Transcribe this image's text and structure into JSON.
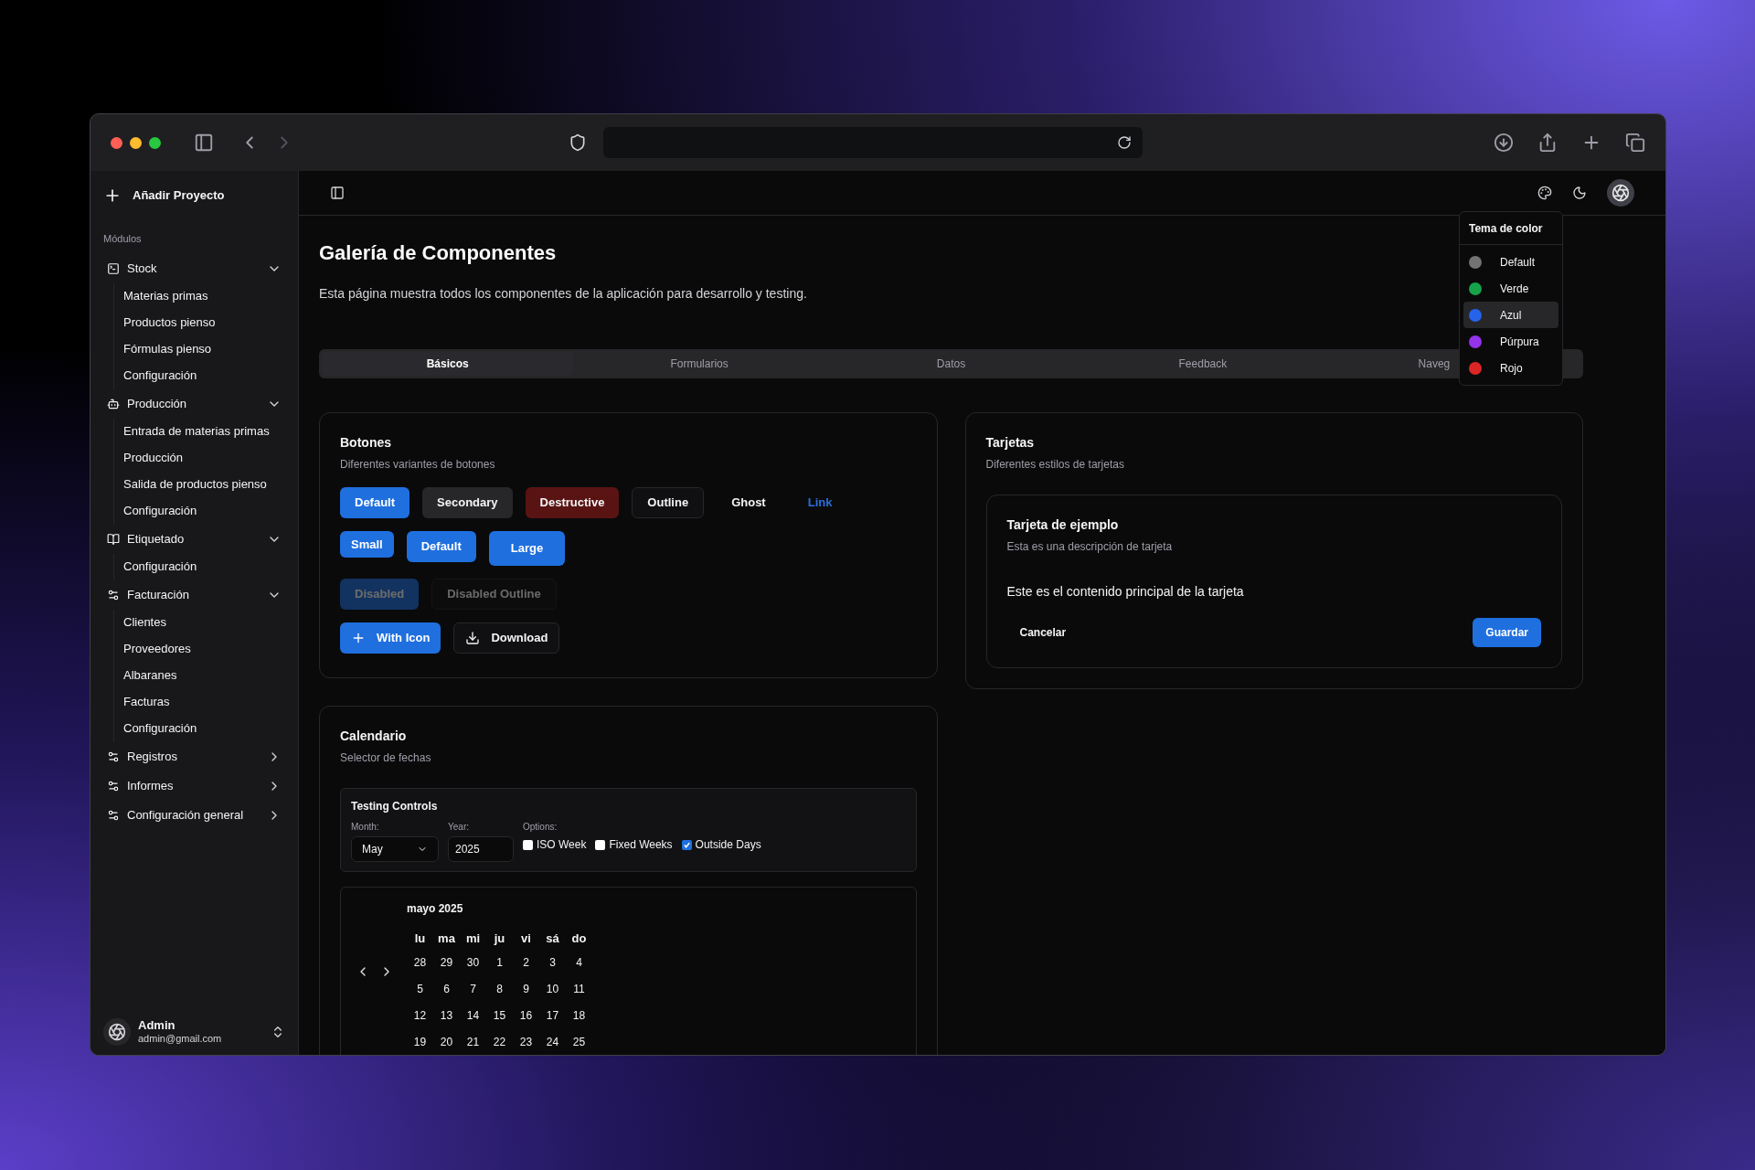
{
  "sidebar": {
    "add_project": "Añadir Proyecto",
    "section_label": "Módulos",
    "items": [
      {
        "label": "Stock",
        "kind": "terminal",
        "expanded": true,
        "children": [
          {
            "label": "Materias primas"
          },
          {
            "label": "Productos pienso"
          },
          {
            "label": "Fórmulas pienso"
          },
          {
            "label": "Configuración"
          }
        ]
      },
      {
        "label": "Producción",
        "kind": "bot",
        "expanded": true,
        "children": [
          {
            "label": "Entrada de materias primas"
          },
          {
            "label": "Producción"
          },
          {
            "label": "Salida de productos pienso"
          },
          {
            "label": "Configuración"
          }
        ]
      },
      {
        "label": "Etiquetado",
        "kind": "book",
        "expanded": true,
        "children": [
          {
            "label": "Configuración"
          }
        ]
      },
      {
        "label": "Facturación",
        "kind": "sliders",
        "expanded": true,
        "children": [
          {
            "label": "Clientes"
          },
          {
            "label": "Proveedores"
          },
          {
            "label": "Albaranes"
          },
          {
            "label": "Facturas"
          },
          {
            "label": "Configuración"
          }
        ]
      },
      {
        "label": "Registros",
        "kind": "sliders",
        "expanded": false
      },
      {
        "label": "Informes",
        "kind": "sliders",
        "expanded": false
      },
      {
        "label": "Configuración general",
        "kind": "sliders",
        "expanded": false
      }
    ],
    "user": {
      "name": "Admin",
      "email": "admin@gmail.com"
    }
  },
  "page": {
    "title": "Galería de Componentes",
    "description": "Esta página muestra todos los componentes de la aplicación para desarrollo y testing."
  },
  "tabs": [
    {
      "label": "Básicos",
      "selected": true
    },
    {
      "label": "Formularios",
      "selected": false
    },
    {
      "label": "Datos",
      "selected": false
    },
    {
      "label": "Feedback",
      "selected": false
    },
    {
      "label": "Naveg",
      "selected": false
    }
  ],
  "color_theme_menu": {
    "title": "Tema de color",
    "options": [
      {
        "label": "Default",
        "color": "#737373",
        "selected": false
      },
      {
        "label": "Verde",
        "color": "#16a34a",
        "selected": false
      },
      {
        "label": "Azul",
        "color": "#2563eb",
        "selected": true
      },
      {
        "label": "Púrpura",
        "color": "#9333ea",
        "selected": false
      },
      {
        "label": "Rojo",
        "color": "#dc2626",
        "selected": false
      }
    ]
  },
  "buttons_card": {
    "title": "Botones",
    "description": "Diferentes variantes de botones",
    "button_rows": [
      {
        "buttons": [
          {
            "label": "Default",
            "kind": "default",
            "disabled": false
          },
          {
            "label": "Secondary",
            "kind": "secondary",
            "disabled": false
          },
          {
            "label": "Destructive",
            "kind": "destructive",
            "disabled": false
          },
          {
            "label": "Outline",
            "kind": "outline",
            "disabled": false
          },
          {
            "label": "Ghost",
            "kind": "ghost",
            "disabled": false
          },
          {
            "label": "Link",
            "kind": "link",
            "disabled": false
          }
        ]
      },
      {
        "buttons": [
          {
            "label": "Small",
            "kind": "small",
            "disabled": false
          },
          {
            "label": "Default",
            "kind": "default",
            "disabled": false
          },
          {
            "label": "Large",
            "kind": "large",
            "disabled": false
          }
        ]
      },
      {
        "buttons": [
          {
            "label": "Disabled",
            "kind": "default",
            "disabled": true
          },
          {
            "label": "Disabled Outline",
            "kind": "outline",
            "disabled": true
          }
        ]
      },
      {
        "buttons": [
          {
            "label": "With Icon",
            "kind": "plus",
            "disabled": false
          },
          {
            "label": "Download",
            "kind": "download",
            "disabled": false
          }
        ]
      }
    ]
  },
  "cards_card": {
    "title": "Tarjetas",
    "description": "Diferentes estilos de tarjetas",
    "example": {
      "title": "Tarjeta de ejemplo",
      "description": "Esta es una descripción de tarjeta",
      "content": "Este es el contenido principal de la tarjeta",
      "cancel": "Cancelar",
      "save": "Guardar"
    }
  },
  "calendar_card": {
    "title": "Calendario",
    "description": "Selector de fechas",
    "controls": {
      "title": "Testing Controls",
      "month_label": "Month:",
      "month_value": "May",
      "year_label": "Year:",
      "year_value": "2025",
      "options_label": "Options:",
      "options": [
        {
          "label": "ISO Week",
          "checked": false
        },
        {
          "label": "Fixed Weeks",
          "checked": false
        },
        {
          "label": "Outside Days",
          "checked": true
        }
      ]
    },
    "calendar": {
      "caption": "mayo 2025",
      "weekdays": [
        "lu",
        "ma",
        "mi",
        "ju",
        "vi",
        "sá",
        "do"
      ],
      "weeks": [
        [
          "28",
          "29",
          "30",
          "1",
          "2",
          "3",
          "4"
        ],
        [
          "5",
          "6",
          "7",
          "8",
          "9",
          "10",
          "11"
        ],
        [
          "12",
          "13",
          "14",
          "15",
          "16",
          "17",
          "18"
        ],
        [
          "19",
          "20",
          "21",
          "22",
          "23",
          "24",
          "25"
        ]
      ]
    }
  }
}
